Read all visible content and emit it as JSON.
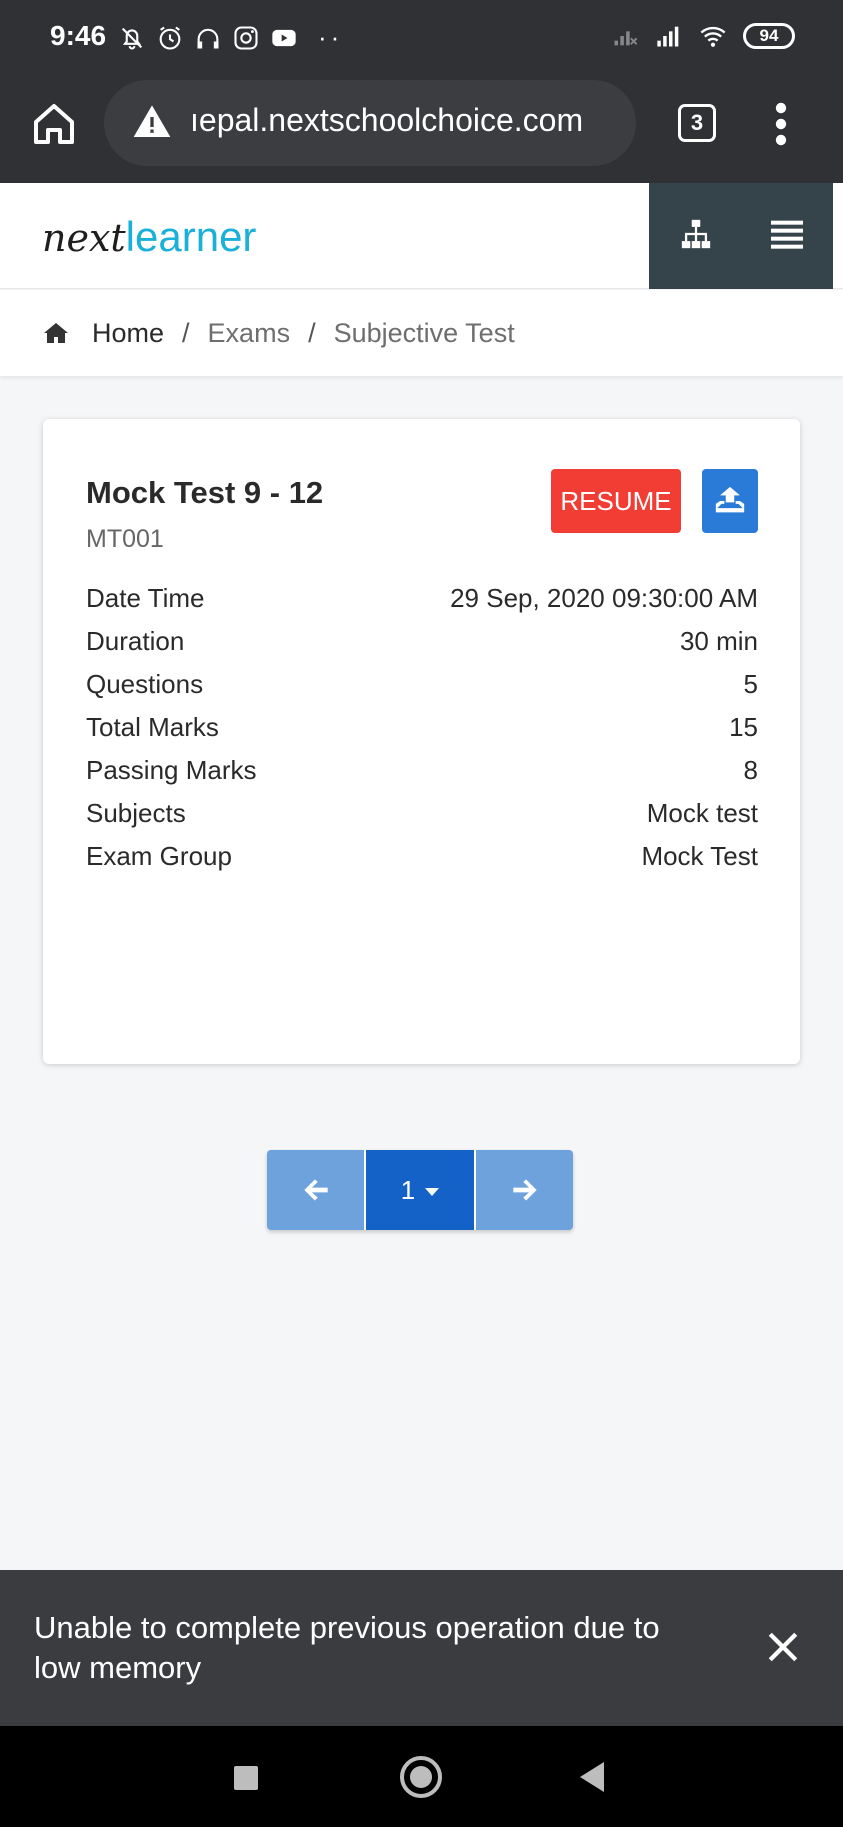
{
  "status_bar": {
    "time": "9:46",
    "battery": "94"
  },
  "browser": {
    "url": "ıepal.nextschoolchoice.com",
    "tab_count": "3"
  },
  "header": {
    "logo_part1": "next",
    "logo_part2": "learner",
    "logo_color": "#1ab0d8",
    "dark_bg": "#35434a"
  },
  "breadcrumb": {
    "home": "Home",
    "separator": "/",
    "section": "Exams",
    "page": "Subjective Test"
  },
  "exam_card": {
    "title": "Mock Test 9 - 12",
    "code": "MT001",
    "resume_label": "RESUME",
    "details": [
      {
        "label": "Date Time",
        "value": "29 Sep, 2020 09:30:00 AM"
      },
      {
        "label": "Duration",
        "value": "30 min"
      },
      {
        "label": "Questions",
        "value": "5"
      },
      {
        "label": "Total Marks",
        "value": "15"
      },
      {
        "label": "Passing Marks",
        "value": "8"
      },
      {
        "label": "Subjects",
        "value": "Mock test"
      },
      {
        "label": "Exam Group",
        "value": "Mock Test"
      }
    ]
  },
  "pagination": {
    "current_page": "1"
  },
  "snackbar": {
    "message": "Unable to complete previous operation due to low memory"
  },
  "colors": {
    "resume": "#f23d35",
    "upload": "#2a7ad8",
    "page_active": "#1462c8",
    "page_inactive": "#6da2dc"
  }
}
